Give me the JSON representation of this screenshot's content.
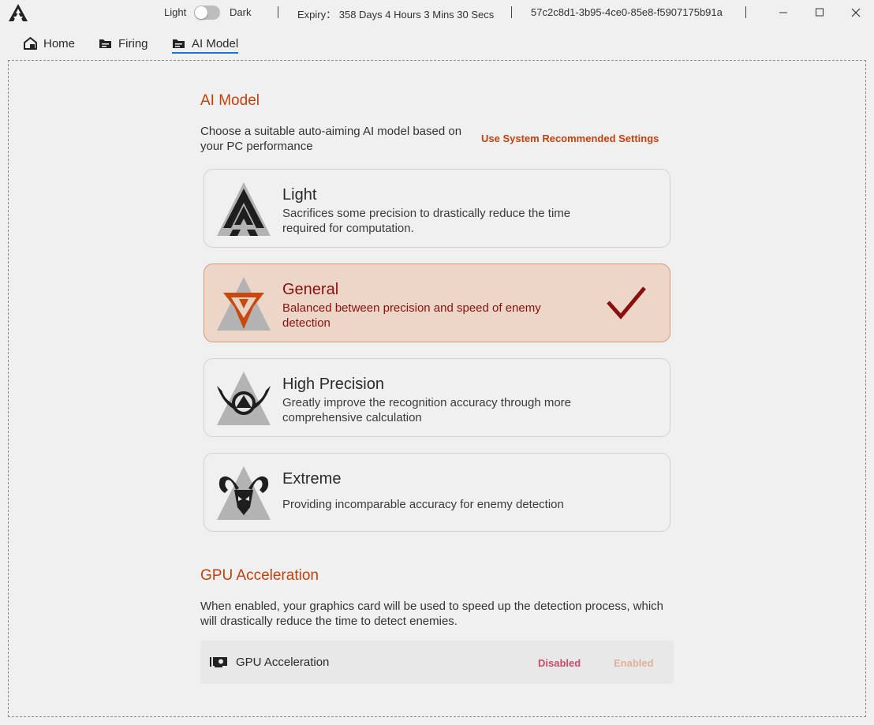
{
  "titlebar": {
    "theme_light": "Light",
    "theme_dark": "Dark",
    "expiry": "Expiry： 358 Days 4 Hours 3 Mins 30 Secs",
    "machine_id": "57c2c8d1-3b95-4ce0-85e8-f5907175b91a"
  },
  "tabs": [
    {
      "label": "Home",
      "icon": "home-icon"
    },
    {
      "label": "Firing",
      "icon": "folder-icon"
    },
    {
      "label": "AI Model",
      "icon": "folder-icon",
      "active": true
    }
  ],
  "ai_model": {
    "title": "AI Model",
    "description": "Choose a suitable auto-aiming AI model based on your PC performance",
    "recommend_label": "Use System Recommended Settings",
    "options": [
      {
        "name": "Light",
        "description": "Sacrifices some precision to drastically reduce the time required for computation.",
        "selected": false
      },
      {
        "name": "General",
        "description": "Balanced between precision and speed of enemy detection",
        "selected": true
      },
      {
        "name": "High Precision",
        "description": "Greatly improve the recognition accuracy through more comprehensive calculation",
        "selected": false
      },
      {
        "name": "Extreme",
        "description": "Providing incomparable accuracy for enemy detection",
        "selected": false
      }
    ]
  },
  "gpu": {
    "title": "GPU Acceleration",
    "description": "When enabled, your graphics card will be used to speed up the detection process, which will drastically reduce the time to detect enemies.",
    "row_label": "GPU Acceleration",
    "disabled_label": "Disabled",
    "enabled_label": "Enabled",
    "state": "Disabled"
  },
  "colors": {
    "accent": "#c2410c",
    "selected_text": "#8b0f0f",
    "selected_bg": "#ecd6c8",
    "tab_underline": "#1e73d9"
  }
}
